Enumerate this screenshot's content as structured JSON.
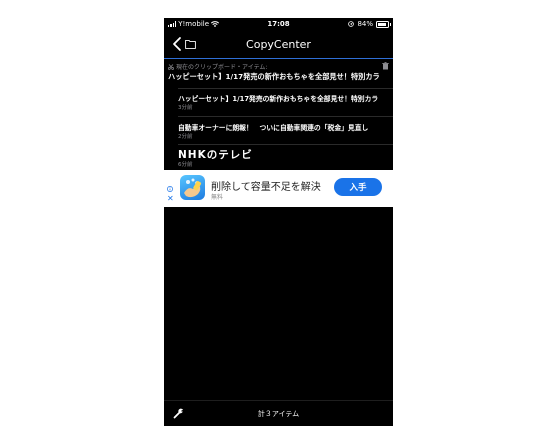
{
  "status_bar": {
    "carrier": "Y!mobile",
    "time": "17:08",
    "battery": "84%",
    "battery_level": 0.84,
    "icons": [
      "signal-icon",
      "wifi-icon",
      "location-icon",
      "battery-icon"
    ]
  },
  "nav": {
    "title": "CopyCenter",
    "icons": [
      "back-chevron-icon",
      "folder-icon"
    ]
  },
  "current_clipboard": {
    "header": "現在のクリップボード・アイテム:",
    "text": "ハッピーセット】1/17発売の新作おもちゃを全部見せ！特別カラ",
    "icons": [
      "scissors-icon",
      "trash-icon"
    ]
  },
  "items": [
    {
      "text": "ハッピーセット】1/17発売の新作おもちゃを全部見せ！特別カラ",
      "time": "3分前"
    },
    {
      "text": "自動車オーナーに朗報！　ついに自動車関連の「税金」見直し",
      "time": "2分前"
    },
    {
      "text": "NHKのテレビ",
      "time": "6分前"
    }
  ],
  "ad": {
    "title": "削除して容量不足を解決",
    "subtitle": "無料",
    "button": "入手",
    "icons": [
      "ad-info-icon",
      "ad-close-icon",
      "app-icon"
    ]
  },
  "footer": {
    "count": "計３アイテム",
    "icons": [
      "wrench-icon"
    ]
  },
  "colors": {
    "background": "#000000",
    "accent_line": "#2f6fd6",
    "ad_button": "#1a73e8",
    "secondary_text": "#8e8e93"
  }
}
